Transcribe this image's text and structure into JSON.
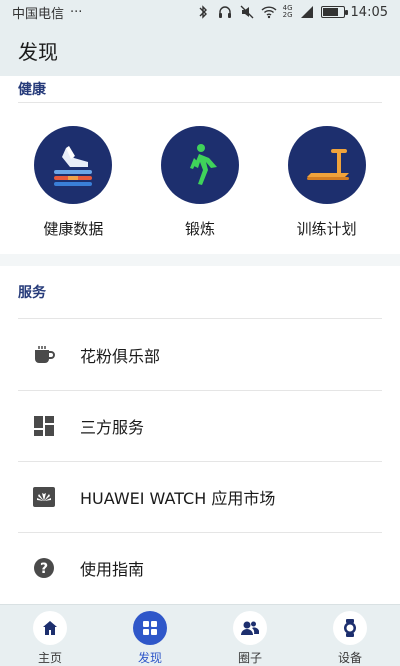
{
  "status_bar": {
    "carrier": "中国电信",
    "more": "···",
    "network_label_top": "4G",
    "network_label_bottom": "2G",
    "time": "14:05",
    "battery_level": 0.7
  },
  "header": {
    "title": "发现"
  },
  "health": {
    "section_title": "健康",
    "items": [
      {
        "label": "健康数据",
        "icon": "health-data-icon"
      },
      {
        "label": "锻炼",
        "icon": "walking-person-icon"
      },
      {
        "label": "训练计划",
        "icon": "treadmill-icon"
      }
    ]
  },
  "services": {
    "section_title": "服务",
    "items": [
      {
        "label": "花粉俱乐部",
        "icon": "cup-icon"
      },
      {
        "label": "三方服务",
        "icon": "grid-icon"
      },
      {
        "label": "HUAWEI WATCH 应用市场",
        "icon": "huawei-logo-icon"
      },
      {
        "label": "使用指南",
        "icon": "help-icon"
      }
    ]
  },
  "bottom_nav": {
    "items": [
      {
        "label": "主页",
        "icon": "home-icon",
        "active": false
      },
      {
        "label": "发现",
        "icon": "discover-grid-icon",
        "active": true
      },
      {
        "label": "圈子",
        "icon": "community-icon",
        "active": false
      },
      {
        "label": "设备",
        "icon": "watch-icon",
        "active": false
      }
    ]
  },
  "colors": {
    "accent": "#2f57c9",
    "section_title": "#263b7a",
    "health_circle": "#1d2f6e"
  }
}
